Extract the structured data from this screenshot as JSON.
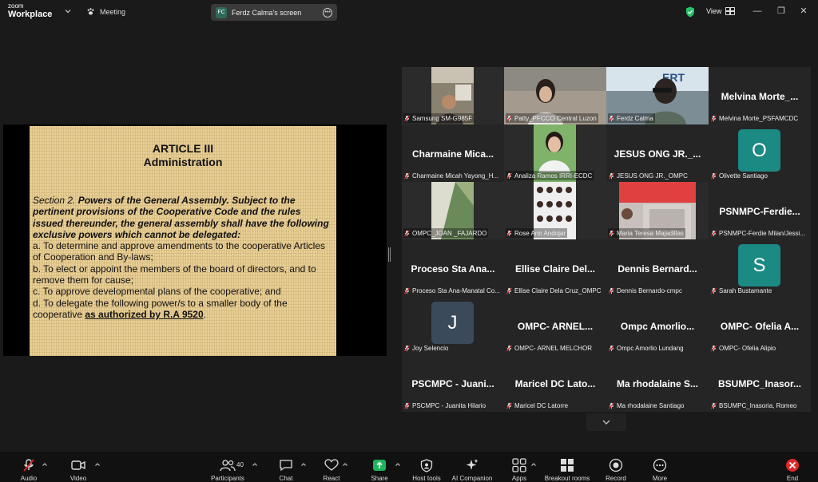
{
  "titlebar": {
    "logo_top": "zoom",
    "logo_bottom": "Workplace",
    "meeting_label": "Meeting",
    "screen_owner_initials": "FC",
    "screen_label": "Ferdz Calma's screen",
    "view_label": "View"
  },
  "slide": {
    "heading_line1": "ARTICLE III",
    "heading_line2": "Administration",
    "section_label": "Section 2.",
    "lead": " Powers of the General Assembly. Subject to the pertinent provisions of the Cooperative Code and the rules issued thereunder, the general assembly shall have the following exclusive powers which cannot be delegated:",
    "item_a": "a. To determine and approve amendments to the cooperative Articles of Cooperation and By-laws;",
    "item_b": "b. To elect or appoint the members of the board of directors, and to remove them for cause;",
    "item_c": "c. To approve developmental plans of the cooperative; and",
    "item_d_pre": "d. To delegate the following power/s to a smaller body of the cooperative ",
    "item_d_ul": "as authorized by R.A 9520",
    "item_d_post": "."
  },
  "gallery": {
    "tiles": [
      {
        "caption": "Samsung SM-G985F",
        "big": "",
        "initial": ""
      },
      {
        "caption": "Patty_PFCCO Central Luzon",
        "big": "",
        "initial": ""
      },
      {
        "caption": "Ferdz Calma",
        "big": "",
        "initial": ""
      },
      {
        "caption": "Melvina Morte_PSFAMCDC",
        "big": "Melvina  Morte_...",
        "initial": ""
      },
      {
        "caption": "Charmaine Micah Yayong_H...",
        "big": "Charmaine  Mica...",
        "initial": ""
      },
      {
        "caption": "Analiza Ramos IRRI-ECDC",
        "big": "",
        "initial": ""
      },
      {
        "caption": "JESUS ONG JR._OMPC",
        "big": "JESUS ONG JR._...",
        "initial": ""
      },
      {
        "caption": "Olivette Santiago",
        "big": "",
        "initial": "O"
      },
      {
        "caption": "OMPC_JOAN _FAJARDO",
        "big": "",
        "initial": ""
      },
      {
        "caption": "Rose Ann Andojar",
        "big": "",
        "initial": ""
      },
      {
        "caption": "Maria Teresa Majadillas",
        "big": "",
        "initial": ""
      },
      {
        "caption": "PSNMPC-Ferdie Milan/Jessi...",
        "big": "PSNMPC-Ferdie...",
        "initial": ""
      },
      {
        "caption": "Proceso Sta Ana-Manatal Co...",
        "big": "Proceso Sta Ana...",
        "initial": ""
      },
      {
        "caption": "Ellise Claire Dela Cruz_OMPC",
        "big": "Ellise  Claire  Del...",
        "initial": ""
      },
      {
        "caption": "Dennis Bernardo-cmpc",
        "big": "Dennis  Bernard...",
        "initial": ""
      },
      {
        "caption": "Sarah Bustamante",
        "big": "",
        "initial": "S"
      },
      {
        "caption": "Joy Selencio",
        "big": "",
        "initial": "J"
      },
      {
        "caption": "OMPC- ARNEL MELCHOR",
        "big": "OMPC-  ARNEL...",
        "initial": ""
      },
      {
        "caption": "Ompc Amorlio Lundang",
        "big": "Ompc  Amorlio...",
        "initial": ""
      },
      {
        "caption": "OMPC- Ofelia Alipio",
        "big": "OMPC-  Ofelia  A...",
        "initial": ""
      },
      {
        "caption": "PSCMPC - Juanita Hilario",
        "big": "PSCMPC  -  Juani...",
        "initial": ""
      },
      {
        "caption": "Maricel DC Latorre",
        "big": "Maricel  DC  Lato...",
        "initial": ""
      },
      {
        "caption": "Ma rhodalaine Santiago",
        "big": "Ma  rhodalaine  S...",
        "initial": ""
      },
      {
        "caption": "BSUMPC_Inasoria, Romeo",
        "big": "BSUMPC_Inasor...",
        "initial": ""
      }
    ]
  },
  "toolbar": {
    "audio": "Audio",
    "video": "Video",
    "participants": "Participants",
    "participants_count": "40",
    "chat": "Chat",
    "react": "React",
    "share": "Share",
    "host_tools": "Host tools",
    "ai_companion": "AI Companion",
    "apps": "Apps",
    "breakout_rooms": "Breakout rooms",
    "record": "Record",
    "more": "More",
    "end": "End"
  },
  "colors": {
    "active_speaker": "#24c36b",
    "end_red": "#e02828",
    "share_green": "#1fb45c",
    "avatar_teal": "#1b8a83",
    "avatar_slate": "#3a4a5a"
  }
}
